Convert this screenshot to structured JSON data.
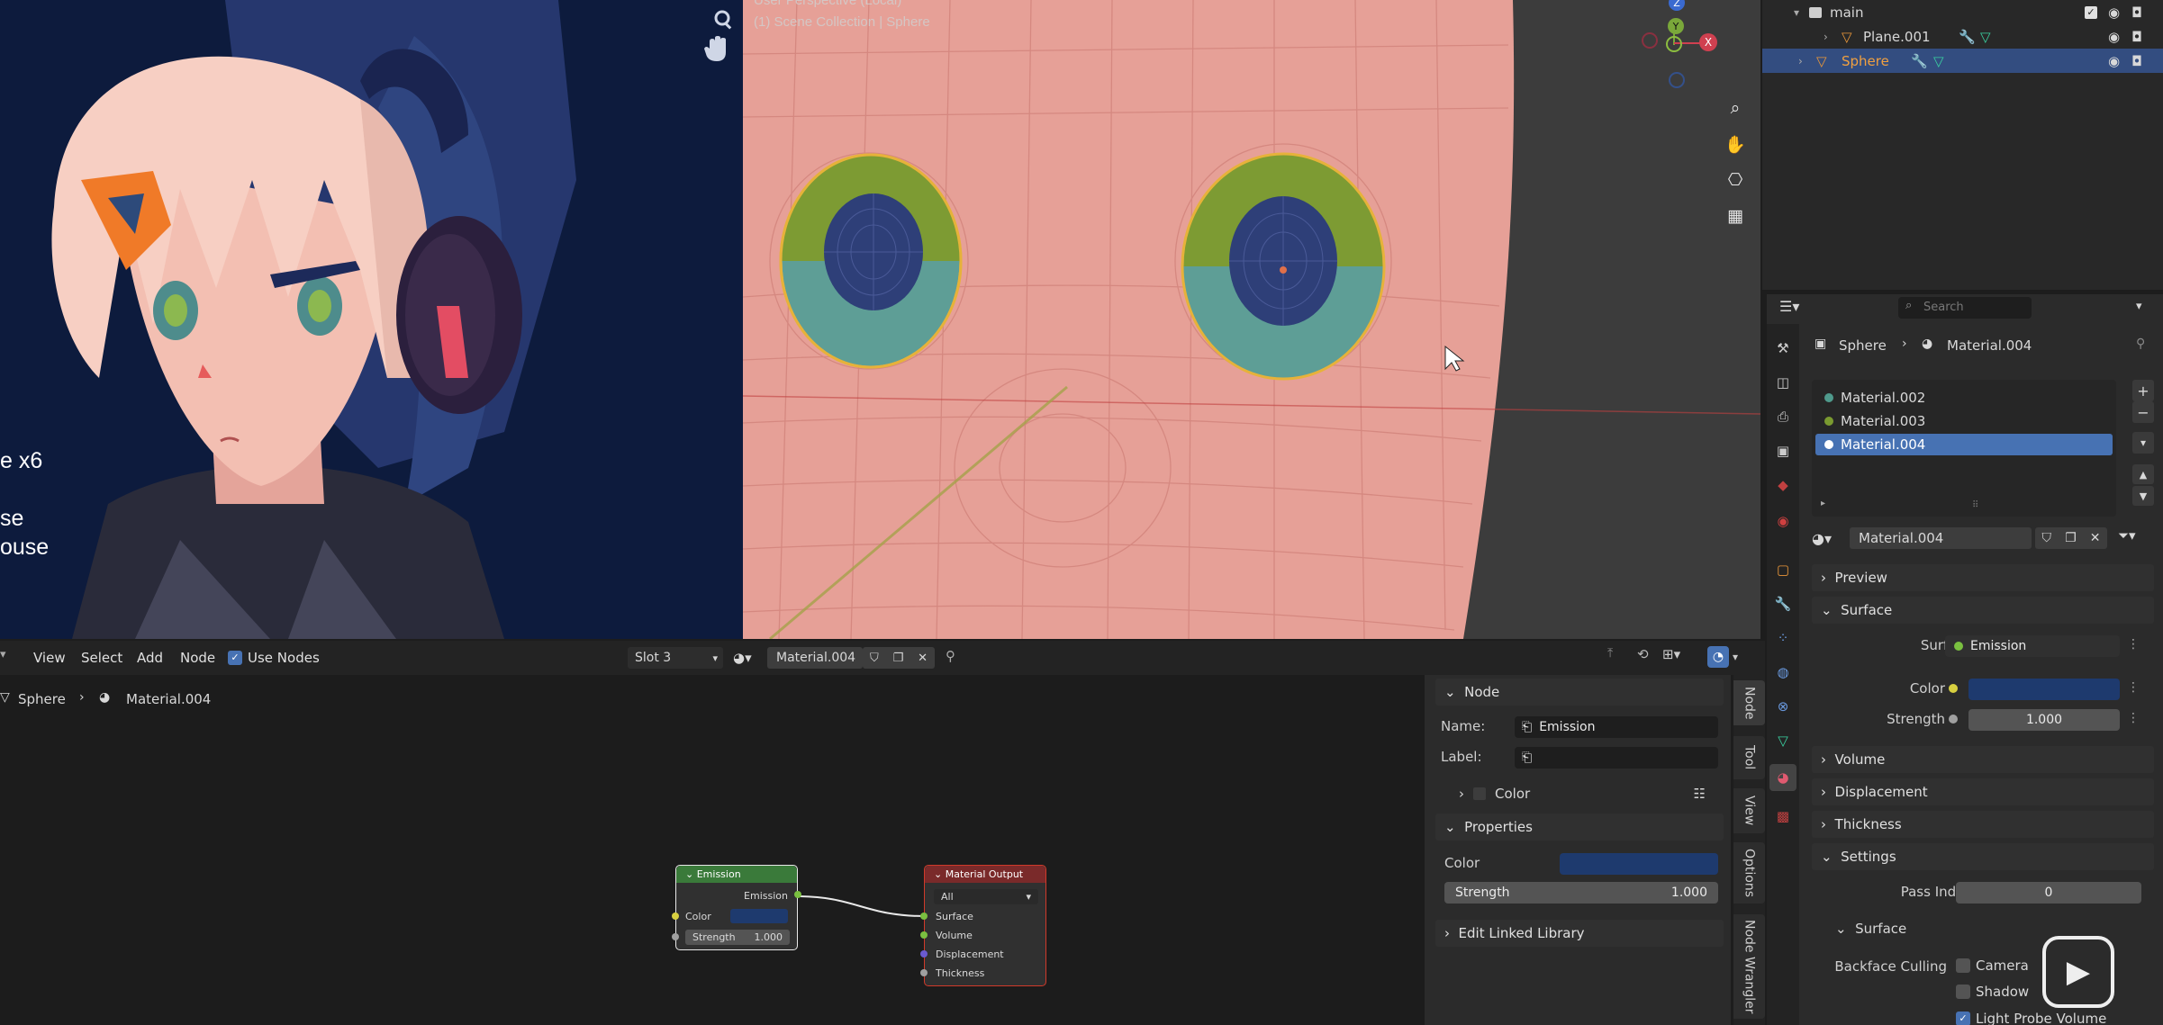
{
  "reference_overlay": {
    "line1": "e x6",
    "line2": "se",
    "line3": "ouse"
  },
  "viewport": {
    "title": "User Perspective (Local)",
    "subtitle": "(1) Scene Collection | Sphere",
    "gizmo": {
      "x": "X",
      "y": "Y",
      "z": "Z"
    }
  },
  "outliner": {
    "rows": [
      {
        "label": "main"
      },
      {
        "label": "Plane.001"
      },
      {
        "label": "Sphere"
      }
    ]
  },
  "properties": {
    "search_placeholder": "Search",
    "breadcrumb_object": "Sphere",
    "breadcrumb_material": "Material.004",
    "material_slots": [
      {
        "label": "Material.002",
        "color": "#4f9a8c"
      },
      {
        "label": "Material.003",
        "color": "#7a9a30"
      },
      {
        "label": "Material.004",
        "color": "#ffffff"
      }
    ],
    "material_name": "Material.004",
    "panels": {
      "preview": "Preview",
      "surface": "Surface",
      "volume": "Volume",
      "displacement": "Displacement",
      "thickness": "Thickness",
      "settings": "Settings",
      "surface_sub": "Surface"
    },
    "surface_label": "Surface",
    "surface_value": "Emission",
    "color_label": "Color",
    "color_value": "#1e3a6e",
    "strength_label": "Strength",
    "strength_value": "1.000",
    "pass_index_label": "Pass Index",
    "pass_index_value": "0",
    "backface_label": "Backface Culling",
    "camera_label": "Camera",
    "shadow_label": "Shadow",
    "light_probe_label": "Light Probe Volume"
  },
  "node_editor": {
    "menu": [
      "View",
      "Select",
      "Add",
      "Node"
    ],
    "use_nodes_label": "Use Nodes",
    "slot_value": "Slot 3",
    "material_name": "Material.004",
    "breadcrumb_object": "Sphere",
    "breadcrumb_material": "Material.004",
    "emission_node": {
      "title": "Emission",
      "output": "Emission",
      "color_label": "Color",
      "strength_label": "Strength",
      "strength_value": "1.000"
    },
    "output_node": {
      "title": "Material Output",
      "target": "All",
      "inputs": [
        "Surface",
        "Volume",
        "Displacement",
        "Thickness"
      ]
    }
  },
  "sidebar": {
    "node_panel": "Node",
    "name_label": "Name:",
    "name_value": "Emission",
    "label_label": "Label:",
    "label_value": "",
    "color_section": "Color",
    "properties_panel": "Properties",
    "color_label": "Color",
    "strength_label": "Strength",
    "strength_value": "1.000",
    "edit_linked": "Edit Linked Library",
    "tabs": [
      "Node",
      "Tool",
      "View",
      "Options",
      "Node Wrangler"
    ]
  },
  "colors": {
    "accent": "#4772b3",
    "selection": "#334d80",
    "emission_header": "#3a7a3a",
    "output_header": "#7a2a2a",
    "color_swatch": "#1e3a6e"
  }
}
